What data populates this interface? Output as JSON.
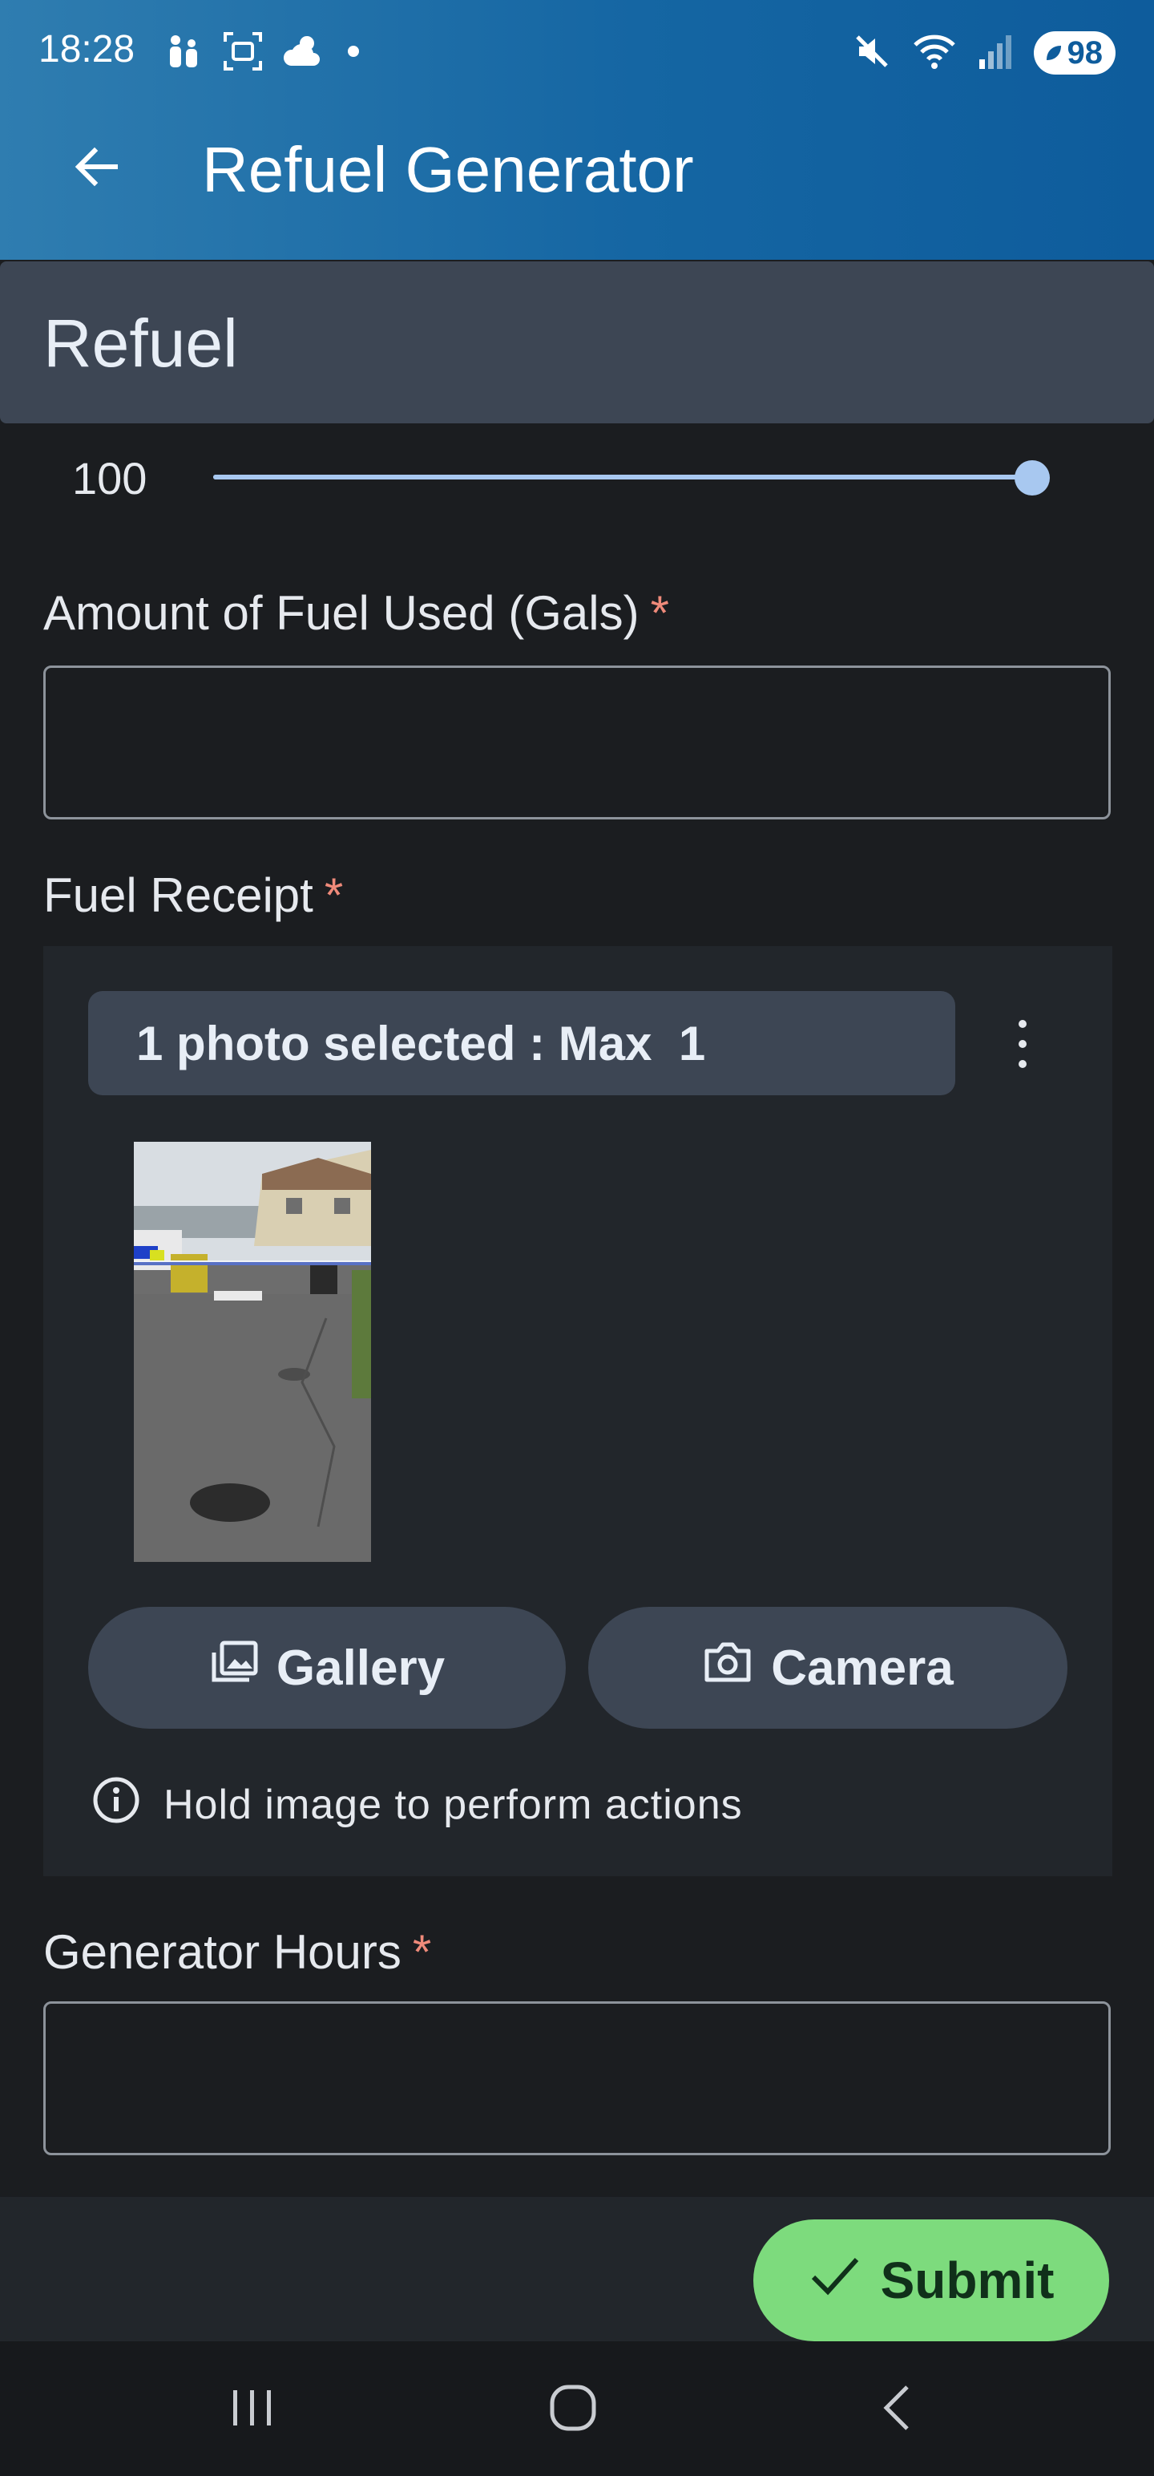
{
  "status_bar": {
    "time": "18:28",
    "battery": "98",
    "left_icons": [
      "family-icon",
      "screenshot-icon",
      "weather-icon",
      "notification-dot-icon"
    ],
    "right_icons": [
      "mute-icon",
      "wifi-icon",
      "signal-icon",
      "battery-icon"
    ]
  },
  "app_bar": {
    "title": "Refuel Generator",
    "back_icon": "arrow-back-icon"
  },
  "section": {
    "title": "Refuel"
  },
  "slider": {
    "value_label": "100",
    "value_fraction": 1.0
  },
  "fields": {
    "fuel_used_label": "Amount of Fuel Used (Gals)",
    "fuel_used_value": "",
    "receipt_label": "Fuel Receipt",
    "generator_hours_label": "Generator Hours",
    "generator_hours_value": "",
    "required_marker": "*"
  },
  "receipt": {
    "selected_text": "1 photo selected : Max  1",
    "gallery_label": "Gallery",
    "camera_label": "Camera",
    "info_text": "Hold image to perform actions"
  },
  "actions": {
    "submit_label": "Submit"
  },
  "colors": {
    "appbar_start": "#2f7db0",
    "appbar_end": "#0e5c9c",
    "background": "#1b1d20",
    "section_header": "#3d4654",
    "slider": "#a8c8f0",
    "required": "#ef8a7a",
    "submit": "#7ddb7d"
  },
  "nav_bar": {
    "icons": [
      "recents-icon",
      "home-icon",
      "back-nav-icon"
    ]
  }
}
